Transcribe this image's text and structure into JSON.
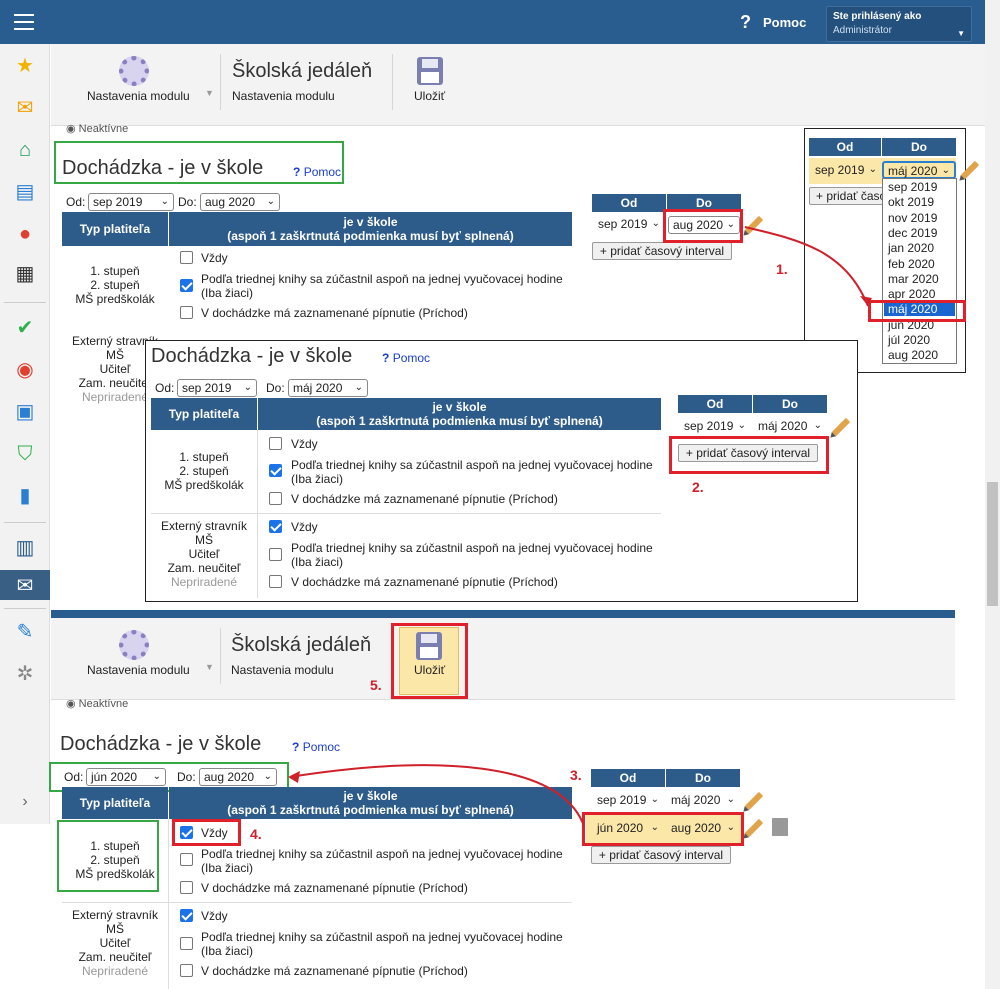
{
  "topbar": {
    "help_label": "Pomoc",
    "user_line1": "Ste prihlásený ako",
    "user_line2": "Administrátor"
  },
  "toolbar": {
    "settings_label": "Nastavenia modulu",
    "title": "Školská jedáleň",
    "subtitle": "Nastavenia modulu",
    "save_label": "Uložiť"
  },
  "inactive_label": "Neaktívne",
  "section": {
    "title": "Dochádzka - je v škole",
    "help_link": "Pomoc"
  },
  "filter": {
    "from_label": "Od:",
    "to_label": "Do:"
  },
  "table": {
    "col1": "Typ platiteľa",
    "col2_line1": "je v škole",
    "col2_line2": "(aspoň 1 zaškrtnutá podmienka musí byť splnená)",
    "group1": [
      "1. stupeň",
      "2. stupeň",
      "MŠ predškolák"
    ],
    "group2": [
      "Externý stravník",
      "MŠ",
      "Učiteľ",
      "Zam. neučiteľ",
      "Nepriradené"
    ],
    "opt_always": "Vždy",
    "opt_book_1": "Podľa triednej knihy sa zúčastnil aspoň na jednej vyučovacej hodine",
    "opt_book_2": "(Iba žiaci)",
    "opt_pin": "V dochádzke má zaznamenané pípnutie (Príchod)"
  },
  "intervals": {
    "col_from": "Od",
    "col_to": "Do",
    "add_button": "+ pridať časový interval",
    "add_button_short": "+ pridať časo"
  },
  "months": {
    "sep2019": "sep 2019",
    "aug2020": "aug 2020",
    "maj2020": "máj 2020",
    "jun2020": "jún 2020"
  },
  "dropdown_options": [
    "sep 2019",
    "okt 2019",
    "nov 2019",
    "dec 2019",
    "jan 2020",
    "feb 2020",
    "mar 2020",
    "apr 2020",
    "máj 2020",
    "jún 2020",
    "júl 2020",
    "aug 2020"
  ],
  "steps": [
    "1.",
    "2.",
    "3.",
    "4.",
    "5."
  ],
  "colors": {
    "header_blue": "#2a5d8f",
    "table_head": "#2e5c8a",
    "annotation_red": "#e0202a",
    "annotation_green": "#35a844",
    "highlight_yellow": "#fbe7a8"
  }
}
